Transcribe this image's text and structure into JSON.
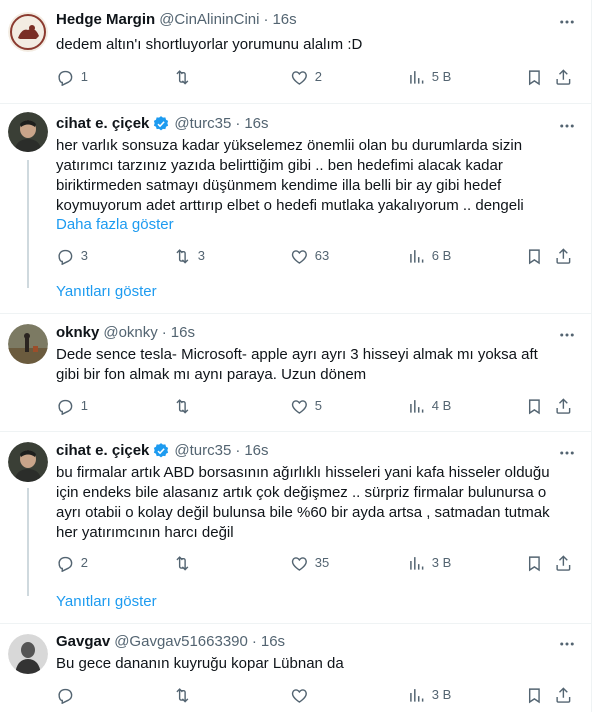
{
  "tweets": [
    {
      "name": "Hedge Margin",
      "handle": "@CinAlininCini",
      "dot": "·",
      "time": "16s",
      "text": "dedem altın'ı shortluyorlar yorumunu alalım :D",
      "replies": "1",
      "retweets": "",
      "likes": "2",
      "views": "5 B"
    },
    {
      "name": "cihat e. çiçek",
      "handle": "@turc35",
      "dot": "·",
      "time": "16s",
      "verified": true,
      "text_lines": [
        "her varlık sonsuza kadar yükselemez önemlii olan bu durumlarda sizin",
        "yatırımcı tarzınız yazıda belirttiğim gibi .. ben hedefimi alacak kadar",
        "biriktirmeden satmayı düşünmem kendime illa belli bir ay gibi hedef",
        "koymuyorum adet arttırıp elbet o hedefi mutlaka yakalıyorum .. dengeli"
      ],
      "show_more": "Daha fazla göster",
      "replies": "3",
      "retweets": "3",
      "likes": "63",
      "views": "6 B",
      "replies_link": "Yanıtları göster"
    },
    {
      "name": "oknky",
      "handle": "@oknky",
      "dot": "·",
      "time": "16s",
      "text_lines": [
        "Dede sence tesla- Microsoft- apple ayrı ayrı 3 hisseyi almak mı yoksa aft",
        "gibi bir fon almak mı aynı paraya. Uzun dönem"
      ],
      "replies": "1",
      "retweets": "",
      "likes": "5",
      "views": "4 B"
    },
    {
      "name": "cihat e. çiçek",
      "handle": "@turc35",
      "dot": "·",
      "time": "16s",
      "verified": true,
      "text_lines": [
        "bu firmalar artık ABD borsasının ağırlıklı hisseleri yani kafa hisseler olduğu",
        "için endeks bile alasanız artık çok değişmez .. sürpriz firmalar bulunursa o",
        "ayrı otabii o kolay değil bulunsa bile %60 bir ayda artsa , satmadan tutmak",
        "her yatırımcının harcı değil"
      ],
      "replies": "2",
      "retweets": "",
      "likes": "35",
      "views": "3 B",
      "replies_link": "Yanıtları göster"
    },
    {
      "name": "Gavgav",
      "handle": "@Gavgav51663390",
      "dot": "·",
      "time": "16s",
      "text": "Bu gece dananın kuyruğu kopar Lübnan da",
      "replies": "",
      "retweets": "",
      "likes": "",
      "views": "3 B"
    }
  ],
  "icons": {
    "reply": "reply-icon",
    "retweet": "retweet-icon",
    "like": "like-icon",
    "views": "views-icon",
    "bookmark": "bookmark-icon",
    "share": "share-icon",
    "more": "more-icon",
    "verified": "verified-badge-icon"
  },
  "colors": {
    "link": "#1d9bf0",
    "secondary": "#536471",
    "border": "#eff3f4"
  }
}
